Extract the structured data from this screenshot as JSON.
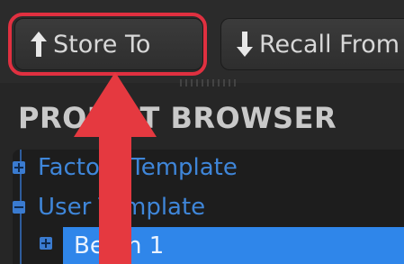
{
  "toolbar": {
    "store_label": "Store To",
    "recall_label": "Recall From"
  },
  "browser": {
    "title": "PROJECT BROWSER",
    "items": [
      {
        "label": "Factory Template",
        "expander": "plus"
      },
      {
        "label": "User Template",
        "expander": "minus"
      },
      {
        "label": "Berlin 1",
        "expander": "plus",
        "selected": true
      }
    ]
  },
  "colors": {
    "annotation": "#e53940",
    "selection": "#2f86ea",
    "tree_text": "#3f86d9"
  },
  "icons": [
    "arrow-up-icon",
    "arrow-down-icon",
    "expander-plus-icon",
    "expander-minus-icon"
  ]
}
